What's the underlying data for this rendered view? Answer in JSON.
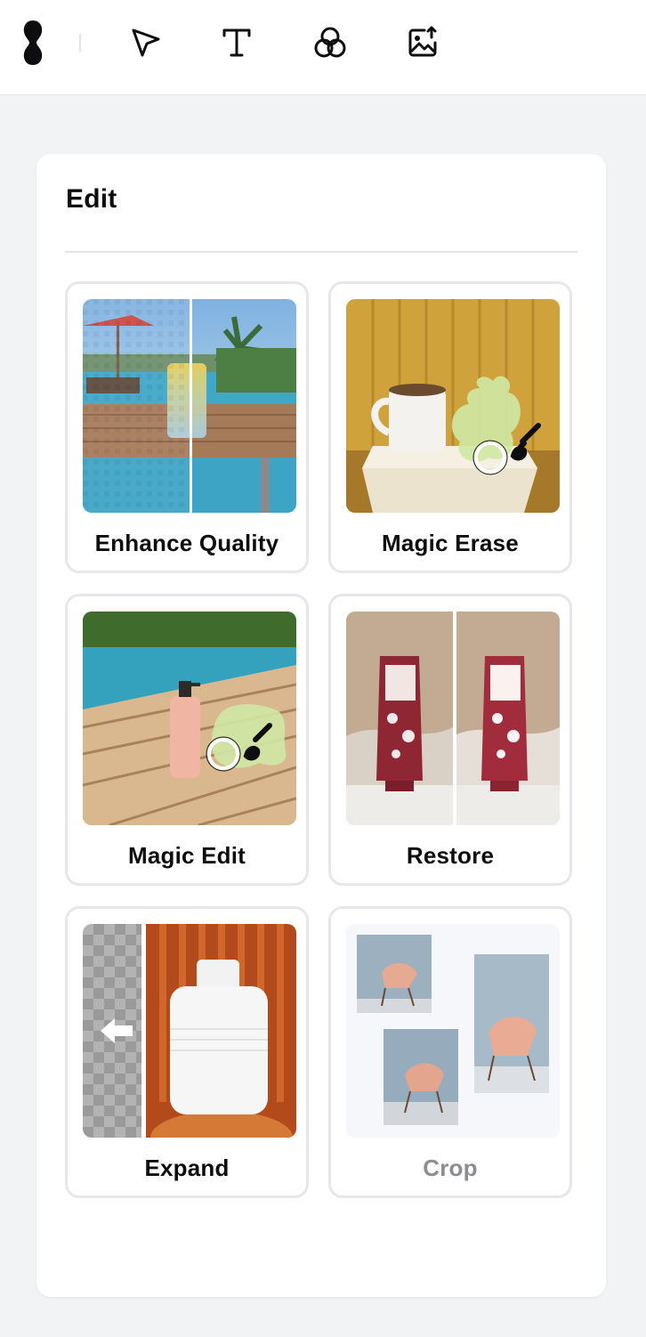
{
  "toolbar": {
    "tools": [
      {
        "icon": "logo-icon"
      },
      {
        "icon": "select-pointer-icon"
      },
      {
        "icon": "text-tool-icon"
      },
      {
        "icon": "color-blend-icon"
      },
      {
        "icon": "image-upload-icon"
      }
    ]
  },
  "panel": {
    "title": "Edit",
    "cards": [
      {
        "label": "Enhance Quality",
        "disabled": false
      },
      {
        "label": "Magic Erase",
        "disabled": false
      },
      {
        "label": "Magic Edit",
        "disabled": false
      },
      {
        "label": "Restore",
        "disabled": false
      },
      {
        "label": "Expand",
        "disabled": false
      },
      {
        "label": "Crop",
        "disabled": true
      }
    ]
  },
  "colors": {
    "background": "#f1f3f5",
    "panel": "#ffffff",
    "card_border": "#e5e7ea",
    "text": "#0e0e10",
    "text_disabled": "#8a8d91"
  }
}
